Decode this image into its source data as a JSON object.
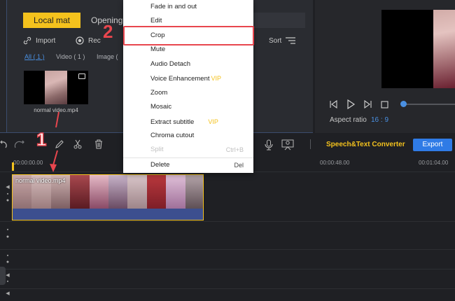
{
  "media_panel": {
    "tabs": [
      {
        "label": "Local mat",
        "active": true
      },
      {
        "label": "Opening",
        "active": false
      }
    ],
    "import_label": "Import",
    "record_label": "Rec",
    "sort_label": "Sort",
    "filters": {
      "all": "All ( 1 )",
      "video": "Video ( 1 )",
      "image": "Image ("
    },
    "media_items": [
      {
        "name": "normal video.mp4"
      }
    ]
  },
  "context_menu": {
    "items": [
      {
        "label": "Fade in and out"
      },
      {
        "label": "Edit"
      },
      {
        "label": "Crop"
      },
      {
        "label": "Mute"
      },
      {
        "label": "Audio Detach"
      },
      {
        "label": "Voice Enhancement",
        "badge": "VIP"
      },
      {
        "label": "Zoom"
      },
      {
        "label": "Mosaic"
      },
      {
        "label": "Extract subtitle",
        "badge": "VIP"
      },
      {
        "label": "Chroma cutout"
      },
      {
        "label": "Split",
        "shortcut": "Ctrl+B",
        "disabled": true
      },
      {
        "label": "Delete",
        "shortcut": "Del"
      }
    ]
  },
  "preview": {
    "aspect_label": "Aspect ratio",
    "aspect_value": "16 : 9",
    "progress": 0
  },
  "toolbar": {
    "speech_converter": "Speech&Text Converter",
    "export_label": "Export"
  },
  "timeline": {
    "ruler_labels": [
      "00:00:00.00",
      "00:00:48.00",
      "00:01:04.00"
    ],
    "clip_title": "normal video.mp4"
  },
  "annotations": {
    "step1": "1",
    "step2": "2"
  },
  "colors": {
    "accent_yellow": "#f4c21d",
    "accent_blue": "#2f7be6",
    "annotation_red": "#e8464e",
    "clip_blue": "#3c4f8f",
    "background": "#1f2024"
  }
}
